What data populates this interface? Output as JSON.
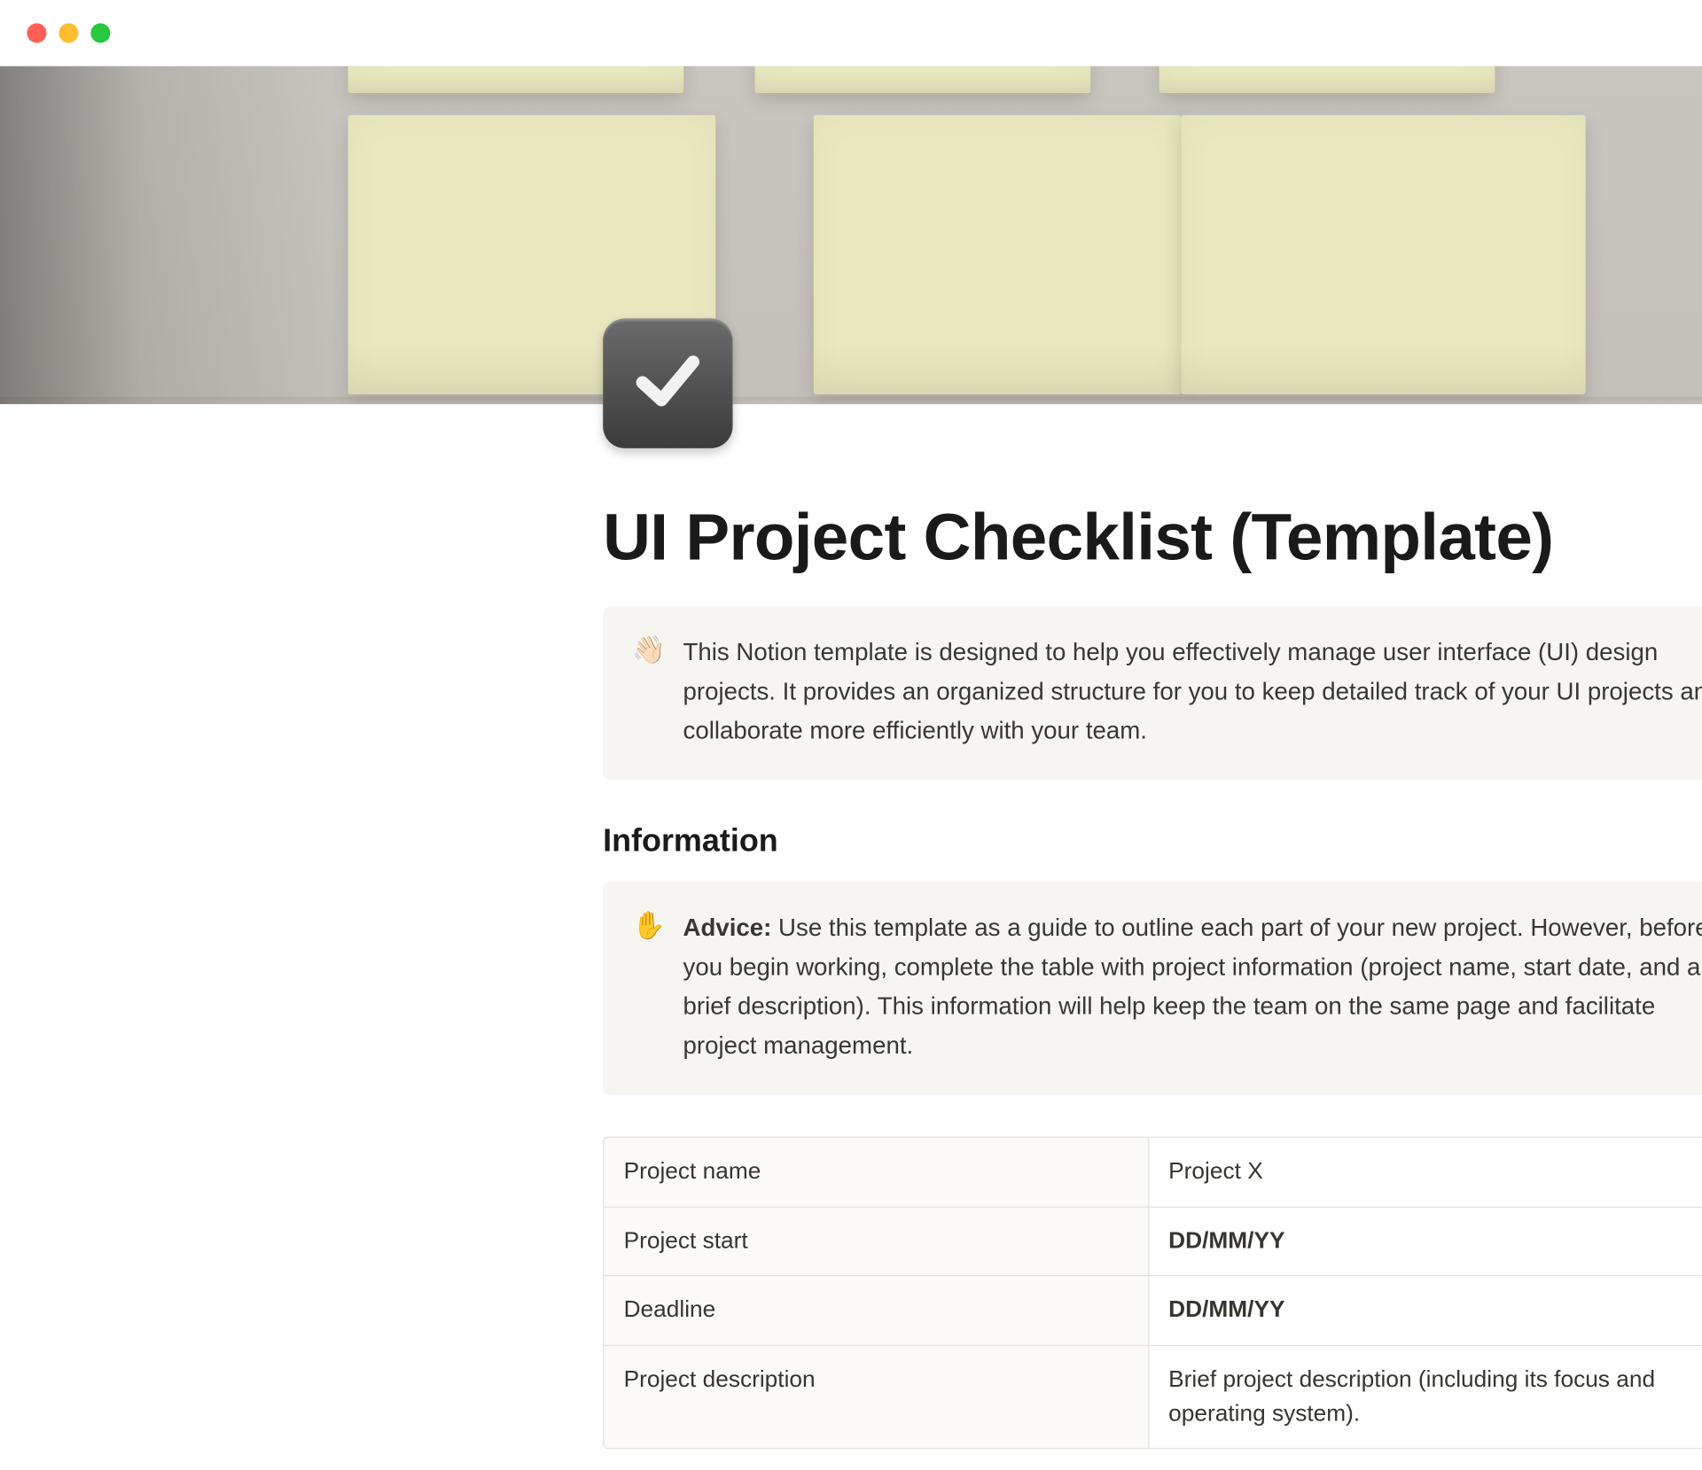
{
  "page": {
    "title": "UI Project Checklist (Template)"
  },
  "intro": {
    "emoji": "👋🏻",
    "text": "This Notion template is designed to help you effectively manage user interface (UI) design projects. It provides an organized structure for you to keep detailed track of your UI projects and collaborate more efficiently with your team."
  },
  "sections": {
    "information": {
      "heading": "Information",
      "advice": {
        "label": "Advice:",
        "text": " Use this template as a guide to outline each part of your new project. However, before you begin working, complete the table with project information (project name, start date, and a brief description). This information will help keep the team on the same page and facilitate project management."
      },
      "table": [
        {
          "key": "Project name",
          "value": "Project X",
          "bold": false
        },
        {
          "key": "Project start",
          "value": "DD/MM/YY",
          "bold": true
        },
        {
          "key": "Deadline",
          "value": "DD/MM/YY",
          "bold": true
        },
        {
          "key": "Project description",
          "value": "Brief project description (including its focus and operating system).",
          "bold": false
        }
      ]
    }
  }
}
